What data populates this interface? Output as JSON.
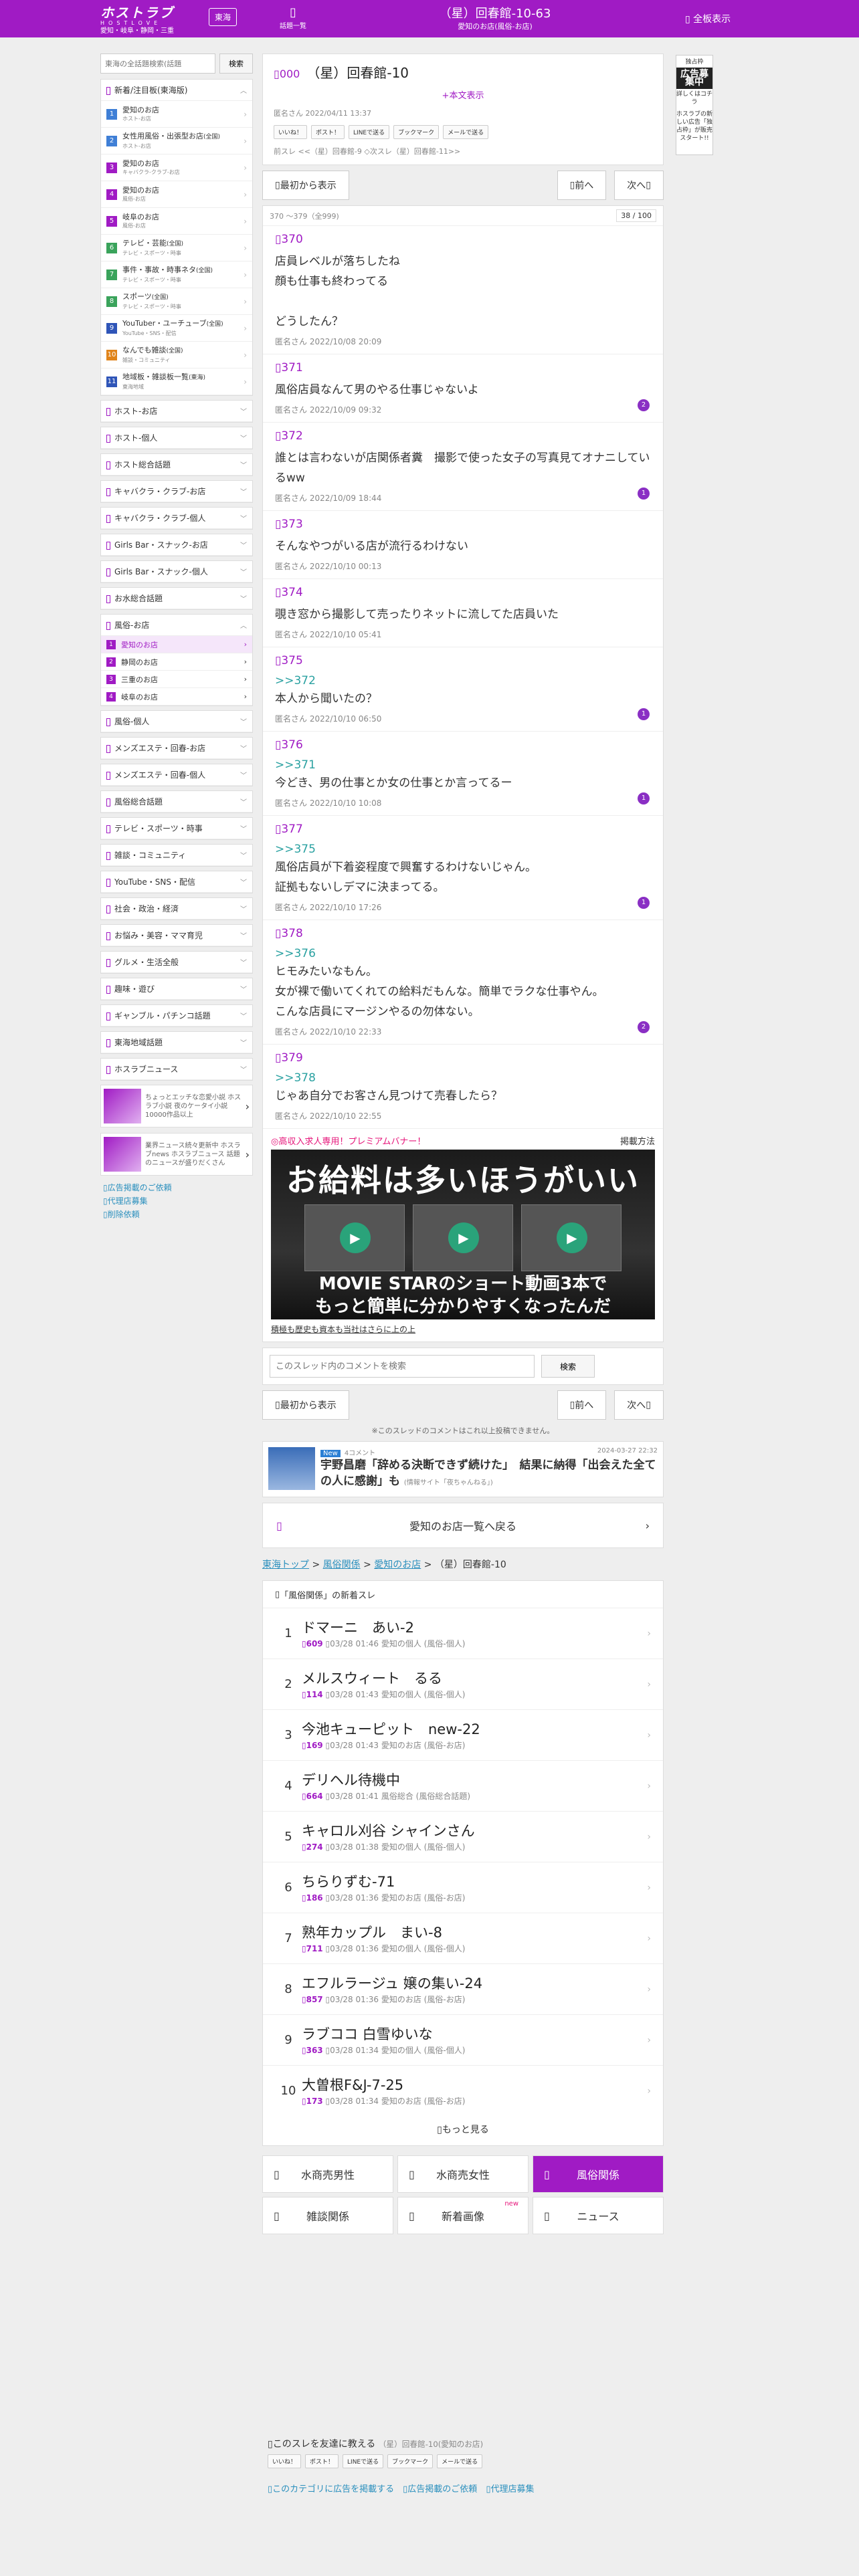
{
  "header": {
    "logo": "ホストラブ",
    "logo_sub": "HOSTLOVE",
    "region_text": "愛知・岐阜・静岡・三重",
    "region_btn": "東海",
    "menu_label": "話題一覧",
    "title": "（星）回春館-10-63",
    "subtitle": "愛知のお店(風俗-お店)",
    "full_label": "全板表示"
  },
  "sidebar": {
    "search_placeholder": "東海の全話題検索(話題",
    "search_btn": "検索",
    "popular_head": "新着/注目板(東海版)",
    "popular": [
      {
        "num": "1",
        "color": "#3f7fd6",
        "label": "愛知のお店",
        "sub": "ホスト-お店"
      },
      {
        "num": "2",
        "color": "#3f7fd6",
        "label": "女性用風俗・出張型お店",
        "sub": "ホスト-お店",
        "tag": "(全国)"
      },
      {
        "num": "3",
        "color": "#a01bc4",
        "label": "愛知のお店",
        "sub": "キャバクラ-クラブ-お店"
      },
      {
        "num": "4",
        "color": "#a01bc4",
        "label": "愛知のお店",
        "sub": "風俗-お店"
      },
      {
        "num": "5",
        "color": "#a01bc4",
        "label": "岐阜のお店",
        "sub": "風俗-お店"
      },
      {
        "num": "6",
        "color": "#3aa35b",
        "label": "テレビ・芸能",
        "sub": "テレビ・スポーツ・時事",
        "tag": "(全国)"
      },
      {
        "num": "7",
        "color": "#3aa35b",
        "label": "事件・事故・時事ネタ",
        "sub": "テレビ・スポーツ・時事",
        "tag": "(全国)"
      },
      {
        "num": "8",
        "color": "#3aa35b",
        "label": "スポーツ",
        "sub": "テレビ・スポーツ・時事",
        "tag": "(全国)"
      },
      {
        "num": "9",
        "color": "#2f55b8",
        "label": "YouTuber・ユーチューブ",
        "sub": "YouTube・SNS・配信",
        "tag": "(全国)"
      },
      {
        "num": "10",
        "color": "#e0841a",
        "label": "なんでも雑談",
        "sub": "雑談・コミュニティ",
        "tag": "(全国)"
      },
      {
        "num": "11",
        "color": "#2f55b8",
        "label": "地域板・雑談板一覧",
        "sub": "東海地域",
        "tag": "(東海)"
      }
    ],
    "sections": [
      "ホスト-お店",
      "ホスト-個人",
      "ホスト総合話題",
      "キャバクラ・クラブ-お店",
      "キャバクラ・クラブ-個人",
      "Girls Bar・スナック-お店",
      "Girls Bar・スナック-個人",
      "お水総合話題"
    ],
    "fuzoku_head": "風俗-お店",
    "fuzoku_items": [
      {
        "num": "1",
        "color": "#a01bc4",
        "label": "愛知のお店"
      },
      {
        "num": "2",
        "color": "#a01bc4",
        "label": "静岡のお店"
      },
      {
        "num": "3",
        "color": "#a01bc4",
        "label": "三重のお店"
      },
      {
        "num": "4",
        "color": "#a01bc4",
        "label": "岐阜のお店"
      }
    ],
    "sections2": [
      "風俗-個人",
      "メンズエステ・回春-お店",
      "メンズエステ・回春-個人",
      "風俗総合話題",
      "テレビ・スポーツ・時事",
      "雑談・コミュニティ",
      "YouTube・SNS・配信",
      "社会・政治・経済",
      "お悩み・美容・ママ育児",
      "グルメ・生活全般",
      "趣味・遊び",
      "ギャンブル・パチンコ話題",
      "東海地域話題",
      "ホスラブニュース"
    ],
    "banners": [
      {
        "text": "ちょっとエッチな恋愛小説 ホスラブ小説 夜のケータイ小説 10000作品以上"
      },
      {
        "text": "業界ニュース続々更新中 ホスラブnews ホスラブニュース 話題のニュースが盛りだくさん"
      }
    ],
    "links": [
      "広告掲載のご依頼",
      "代理店募集",
      "削除依頼"
    ]
  },
  "ad_right": {
    "l1": "独占枠",
    "l2": "広告募集中",
    "l3": "詳しくはコチラ",
    "l4": "ホスラブの新しい広告「独占枠」が販売スタート!!"
  },
  "thread": {
    "no": "000",
    "title": "（星）回春館-10",
    "body_link": "+本文表示",
    "meta": "匿名さん 2022/04/11 13:37",
    "share": [
      "いいね！",
      "ポスト！",
      "LINEで送る",
      "ブックマーク",
      "メールで送る"
    ],
    "related": "前スレ <<（星）回春館-9 ◇次スレ（星）回春館-11>>"
  },
  "nav": {
    "first": "最初から表示",
    "prev": "前へ",
    "next": "次へ"
  },
  "postlist": {
    "range": "370 〜379（全999)",
    "page": "38 / 100"
  },
  "posts": [
    {
      "no": "370",
      "anchor": "",
      "body": "店員レベルが落ちしたね\n顔も仕事も終わってる\n\nどうしたん？",
      "meta": "匿名さん 2022/10/08 20:09",
      "badge": ""
    },
    {
      "no": "371",
      "anchor": "",
      "body": "風俗店員なんて男のやる仕事じゃないよ",
      "meta": "匿名さん 2022/10/09 09:32",
      "badge": "2"
    },
    {
      "no": "372",
      "anchor": "",
      "body": "誰とは言わないが店関係者糞　撮影で使った女子の写真見てオナニしているww",
      "meta": "匿名さん 2022/10/09 18:44",
      "badge": "1"
    },
    {
      "no": "373",
      "anchor": "",
      "body": "そんなやつがいる店が流行るわけない",
      "meta": "匿名さん 2022/10/10 00:13",
      "badge": ""
    },
    {
      "no": "374",
      "anchor": "",
      "body": "覗き窓から撮影して売ったりネットに流してた店員いた",
      "meta": "匿名さん 2022/10/10 05:41",
      "badge": ""
    },
    {
      "no": "375",
      "anchor": ">>372",
      "body": "本人から聞いたの？",
      "meta": "匿名さん 2022/10/10 06:50",
      "badge": "1"
    },
    {
      "no": "376",
      "anchor": ">>371",
      "body": "今どき、男の仕事とか女の仕事とか言ってるー",
      "meta": "匿名さん 2022/10/10 10:08",
      "badge": "1"
    },
    {
      "no": "377",
      "anchor": ">>375",
      "body": "風俗店員が下着姿程度で興奮するわけないじゃん。\n証拠もないしデマに決まってる。",
      "meta": "匿名さん 2022/10/10 17:26",
      "badge": "1"
    },
    {
      "no": "378",
      "anchor": ">>376",
      "body": "ヒモみたいなもん。\n女が裸で働いてくれての給料だもんな。簡単でラクな仕事やん。\nこんな店員にマージンやるの勿体ない。",
      "meta": "匿名さん 2022/10/10 22:33",
      "badge": "2"
    },
    {
      "no": "379",
      "anchor": ">>378",
      "body": "じゃあ自分でお客さん見つけて売春したら？",
      "meta": "匿名さん 2022/10/10 22:55",
      "badge": ""
    }
  ],
  "premium": {
    "label": "◎高収入求人専用！プレミアムバナー！",
    "how": "掲載方法",
    "headline": "お給料は多いほうがいい",
    "sub1": "MOVIE STARのショート動画3本で",
    "sub2": "もっと簡単に分かりやすくなったんだ",
    "foot": "積極も歴史も資本も当社はさらに上の上"
  },
  "comment_search": {
    "placeholder": "このスレッド内のコメントを検索",
    "btn": "検索"
  },
  "note": "※このスレッドのコメントはこれ以上投稿できません。",
  "news": {
    "tag": "New",
    "comments": "4コメント",
    "date": "2024-03-27 22:32",
    "title": "宇野昌磨「辞める決断できず続けた」　結果に納得「出会えた全ての人に感謝」も",
    "source": "(情報サイト「夜ちゃんねる」)"
  },
  "backlink": "愛知のお店一覧へ戻る",
  "breadcrumb": [
    "東海トップ",
    "風俗関係",
    "愛知のお店",
    "（星）回春館-10"
  ],
  "new_threads": {
    "head": "「風俗関係」の新着スレ",
    "items": [
      {
        "rank": "1",
        "title": "ドマーニ　あい-2",
        "count": "609",
        "meta": "03/28 01:46 愛知の個人 (風俗-個人)"
      },
      {
        "rank": "2",
        "title": "メルスウィート　るる",
        "count": "114",
        "meta": "03/28 01:43 愛知の個人 (風俗-個人)"
      },
      {
        "rank": "3",
        "title": "今池キューピット　new-22",
        "count": "169",
        "meta": "03/28 01:43 愛知のお店 (風俗-お店)"
      },
      {
        "rank": "4",
        "title": "デリヘル待機中",
        "count": "664",
        "meta": "03/28 01:41 風俗総合 (風俗総合話題)"
      },
      {
        "rank": "5",
        "title": "キャロル刈谷 シャインさん",
        "count": "274",
        "meta": "03/28 01:38 愛知の個人 (風俗-個人)"
      },
      {
        "rank": "6",
        "title": "ちらりずむ-71",
        "count": "186",
        "meta": "03/28 01:36 愛知のお店 (風俗-お店)"
      },
      {
        "rank": "7",
        "title": "熟年カップル　まい-8",
        "count": "711",
        "meta": "03/28 01:36 愛知の個人 (風俗-個人)"
      },
      {
        "rank": "8",
        "title": "エフルラージュ 嬢の集い-24",
        "count": "857",
        "meta": "03/28 01:36 愛知のお店 (風俗-お店)"
      },
      {
        "rank": "9",
        "title": "ラブココ 白雪ゆいな",
        "count": "363",
        "meta": "03/28 01:34 愛知の個人 (風俗-個人)"
      },
      {
        "rank": "10",
        "title": "大曽根F&J-7-25",
        "count": "173",
        "meta": "03/28 01:34 愛知のお店 (風俗-お店)"
      }
    ],
    "more": "もっと見る"
  },
  "categories": [
    {
      "label": "水商売男性",
      "active": false
    },
    {
      "label": "水商売女性",
      "active": false
    },
    {
      "label": "風俗関係",
      "active": true
    },
    {
      "label": "雑談関係",
      "active": false
    },
    {
      "label": "新着画像",
      "active": false,
      "new": "new"
    },
    {
      "label": "ニュース",
      "active": false
    }
  ],
  "footer": {
    "share_title": "このスレを友達に教える",
    "share_sub": "（星）回春館-10(愛知のお店)",
    "links": [
      "このカテゴリに広告を掲載する",
      "広告掲載のご依頼",
      "代理店募集"
    ]
  }
}
